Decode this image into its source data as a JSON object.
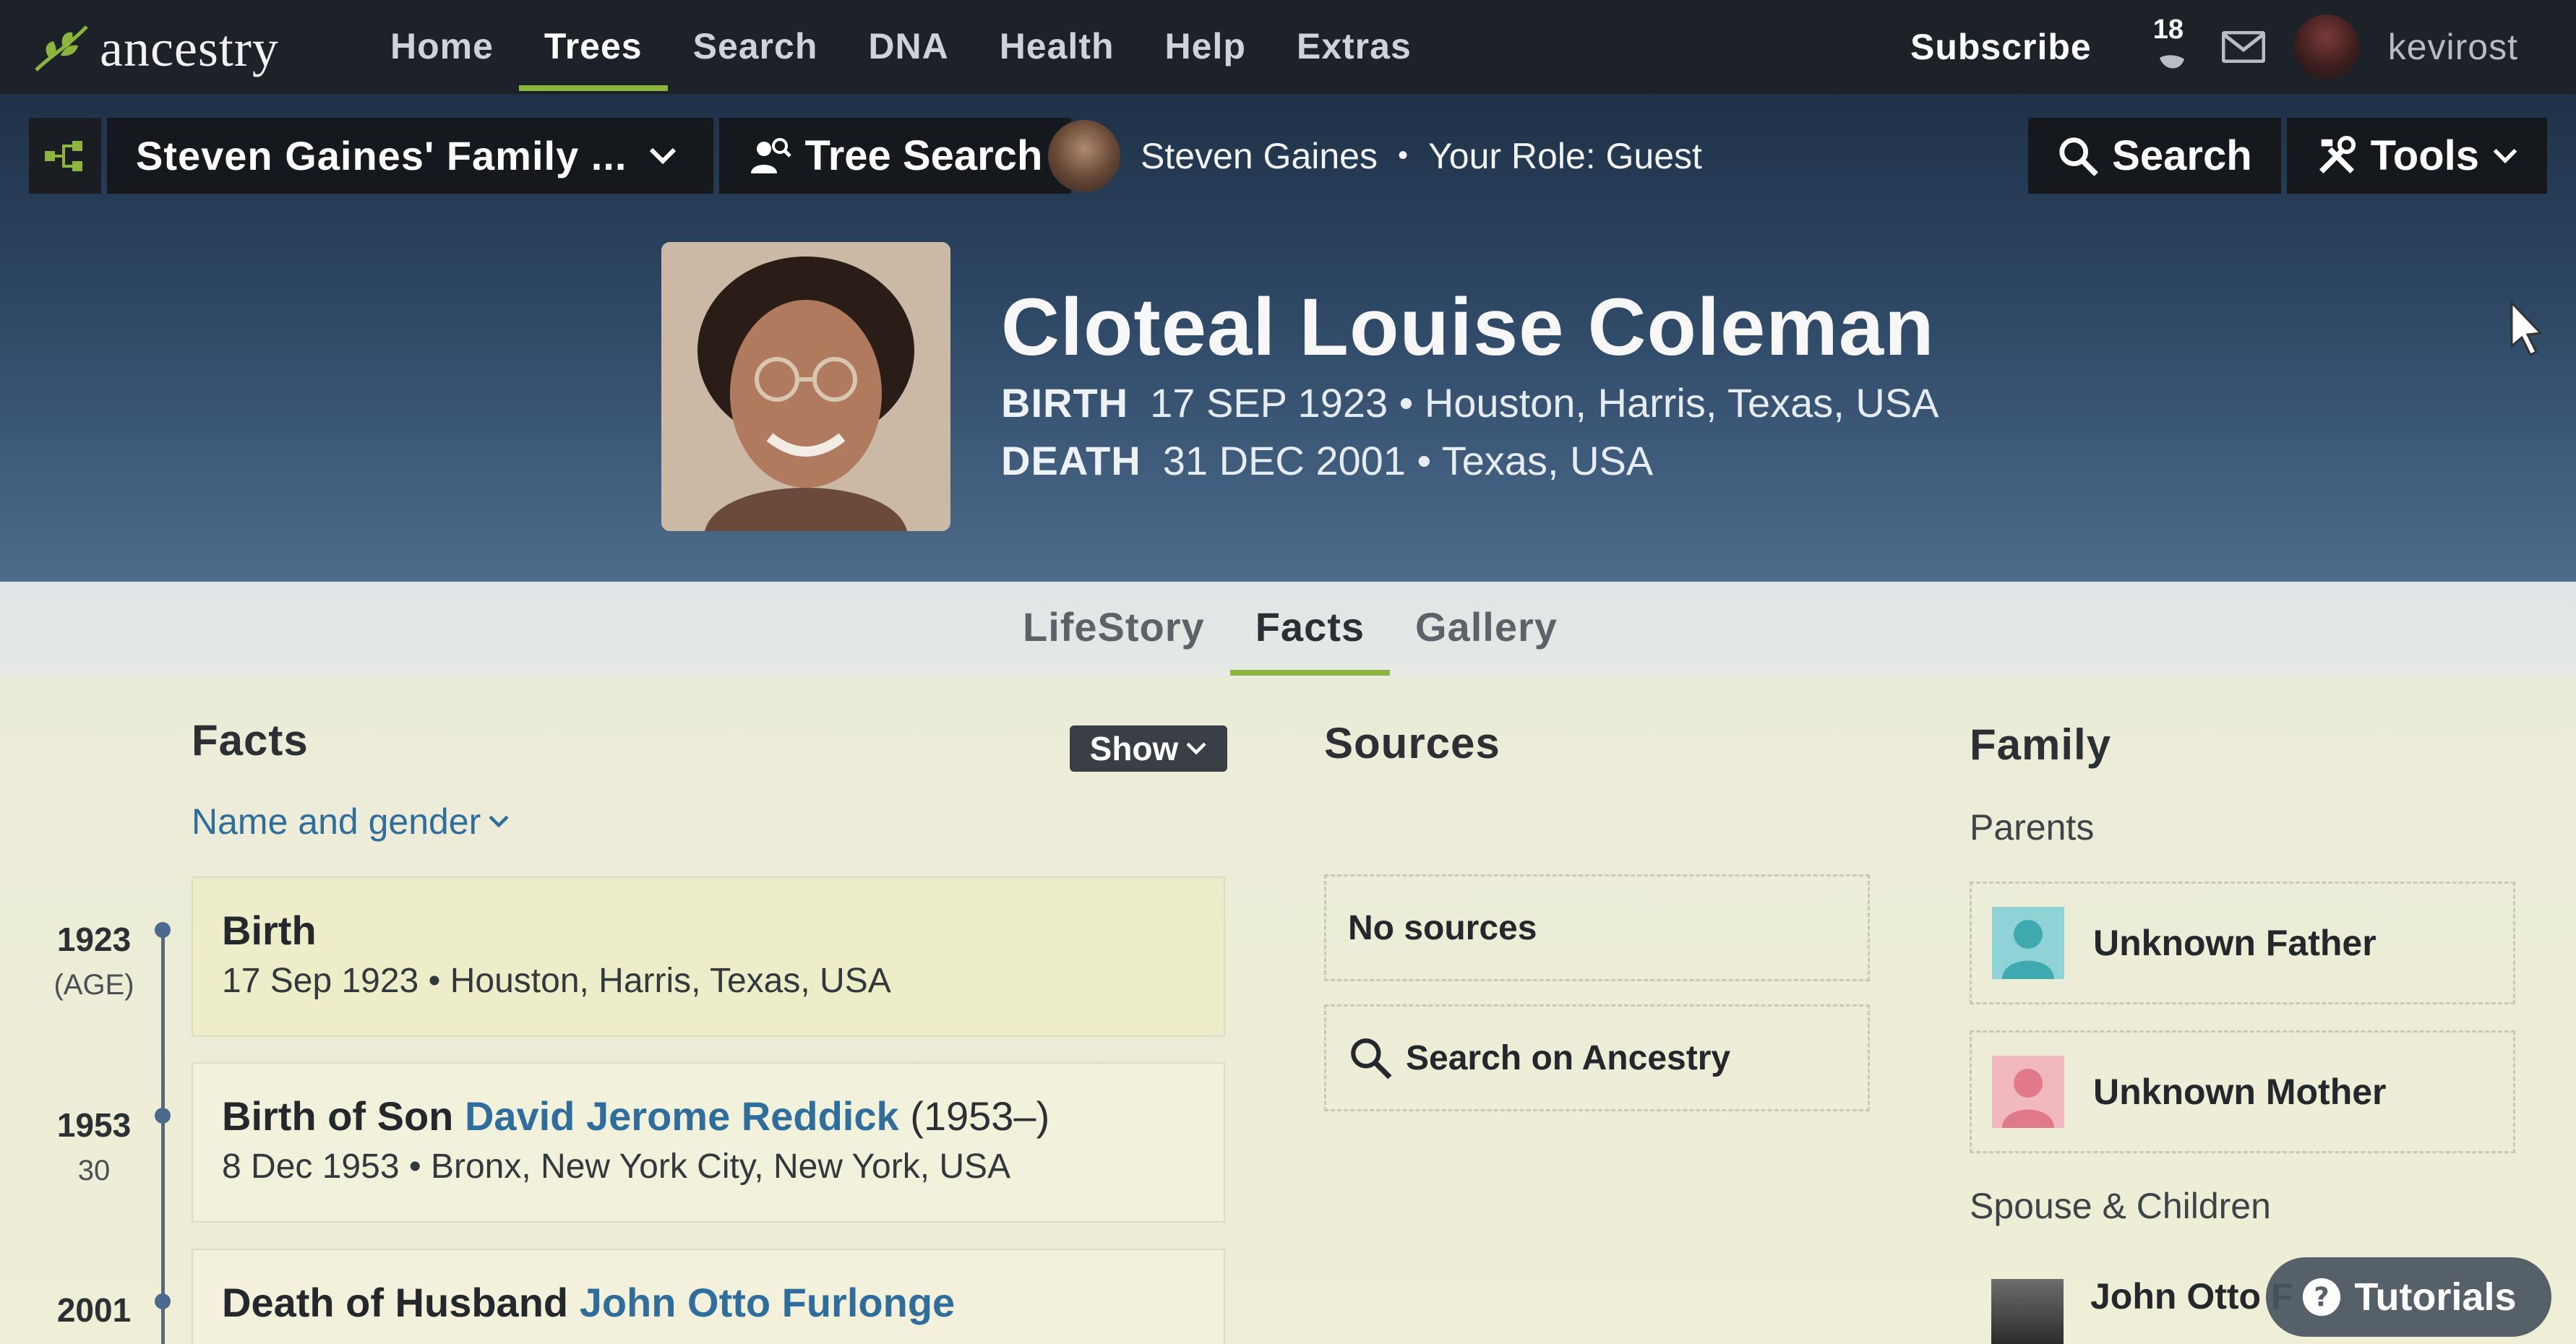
{
  "topnav": {
    "logo_text": "ancestry",
    "links": [
      "Home",
      "Trees",
      "Search",
      "DNA",
      "Health",
      "Help",
      "Extras"
    ],
    "active_link": "Trees",
    "subscribe": "Subscribe",
    "notification_count": "18",
    "username": "kevirost"
  },
  "treebar": {
    "tree_name": "Steven Gaines' Family ...",
    "tree_search": "Tree Search",
    "owner_name": "Steven Gaines",
    "role": "Your Role: Guest",
    "search": "Search",
    "tools": "Tools"
  },
  "person": {
    "name": "Cloteal Louise Coleman",
    "birth_label": "BIRTH",
    "birth_value": "17 SEP 1923 • Houston, Harris, Texas, USA",
    "death_label": "DEATH",
    "death_value": "31 DEC 2001 • Texas, USA"
  },
  "tabs": [
    "LifeStory",
    "Facts",
    "Gallery"
  ],
  "active_tab": "Facts",
  "facts": {
    "title": "Facts",
    "show_button": "Show",
    "filter": "Name and gender",
    "items": [
      {
        "year": "1923",
        "age": "(AGE)",
        "title": "Birth",
        "detail": "17 Sep 1923 • Houston, Harris, Texas, USA"
      },
      {
        "year": "1953",
        "age": "30",
        "title_prefix": "Birth of Son",
        "link": "David Jerome Reddick",
        "years": "(1953–)",
        "detail": "8 Dec 1953 • Bronx, New York City, New York, USA"
      },
      {
        "year": "2001",
        "title_prefix": "Death of Husband",
        "link": "John Otto Furlonge"
      }
    ]
  },
  "sources": {
    "title": "Sources",
    "none": "No sources",
    "search": "Search on Ancestry"
  },
  "family": {
    "title": "Family",
    "parents_label": "Parents",
    "father": "Unknown Father",
    "mother": "Unknown Mother",
    "spouse_label": "Spouse & Children",
    "spouse_name": "John Otto F"
  },
  "tutorials": "Tutorials",
  "colors": {
    "accent_green": "#8cb53f",
    "link_blue": "#2f6d9c",
    "nav_bg": "#1d2128"
  }
}
